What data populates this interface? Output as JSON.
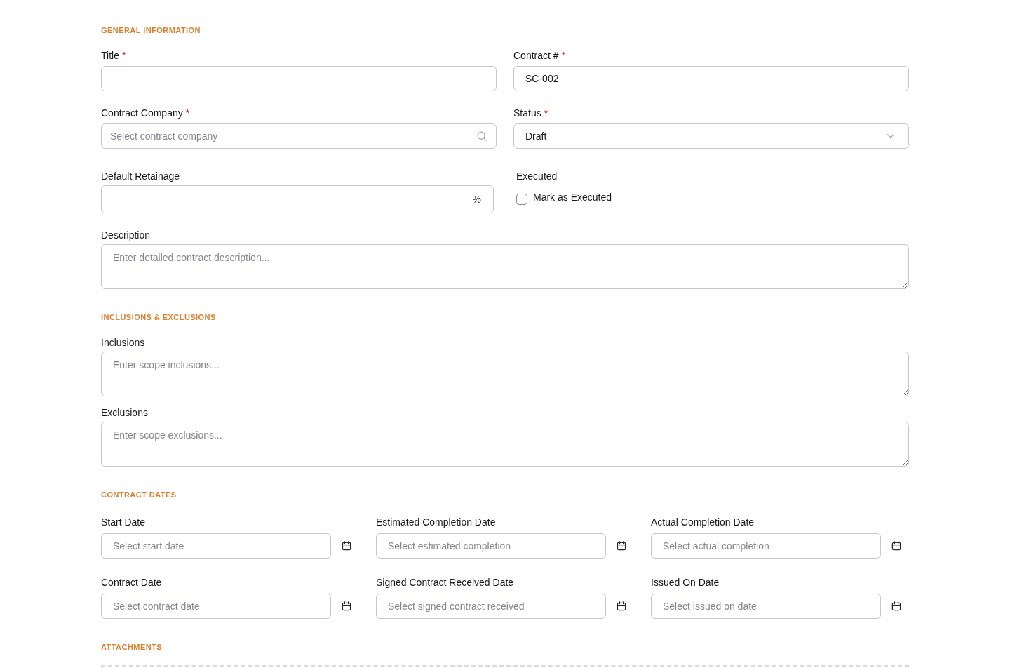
{
  "required_mark": "*",
  "sections": [
    {
      "kind": "form",
      "heading": "GENERAL INFORMATION",
      "fields": [
        {
          "kind": "text",
          "label": "Title",
          "required": true
        },
        {
          "kind": "text",
          "label": "Contract #",
          "required": true,
          "value": "SC-002"
        },
        {
          "kind": "search",
          "label": "Contract Company",
          "required": true,
          "placeholder": "Select contract company"
        },
        {
          "kind": "select",
          "label": "Status",
          "required": true,
          "value": "Draft"
        },
        {
          "kind": "percent",
          "label": "Default Retainage",
          "required": false,
          "suffix": "%"
        },
        {
          "kind": "checkbox",
          "label": "Executed",
          "required": false,
          "option": "Mark as Executed",
          "checked": false
        },
        {
          "kind": "textarea",
          "label": "Description",
          "required": false,
          "placeholder": "Enter detailed contract description..."
        }
      ]
    },
    {
      "kind": "notes",
      "heading": "INCLUSIONS & EXCLUSIONS",
      "fields": [
        {
          "kind": "textarea",
          "label": "Inclusions",
          "required": false,
          "placeholder": "Enter scope inclusions..."
        },
        {
          "kind": "textarea",
          "label": "Exclusions",
          "required": false,
          "placeholder": "Enter scope exclusions..."
        }
      ]
    },
    {
      "kind": "dates",
      "heading": "CONTRACT DATES",
      "fields": [
        {
          "kind": "date",
          "label": "Start Date",
          "required": false,
          "placeholder": "Select start date"
        },
        {
          "kind": "date",
          "label": "Estimated Completion Date",
          "required": false,
          "placeholder": "Select estimated completion"
        },
        {
          "kind": "date",
          "label": "Actual Completion Date",
          "required": false,
          "placeholder": "Select actual completion"
        },
        {
          "kind": "date",
          "label": "Contract Date",
          "required": false,
          "placeholder": "Select contract date"
        },
        {
          "kind": "date",
          "label": "Signed Contract Received Date",
          "required": false,
          "placeholder": "Select signed contract received"
        },
        {
          "kind": "date",
          "label": "Issued On Date",
          "required": false,
          "placeholder": "Select issued on date"
        }
      ]
    },
    {
      "kind": "attachments",
      "heading": "ATTACHMENTS"
    }
  ]
}
